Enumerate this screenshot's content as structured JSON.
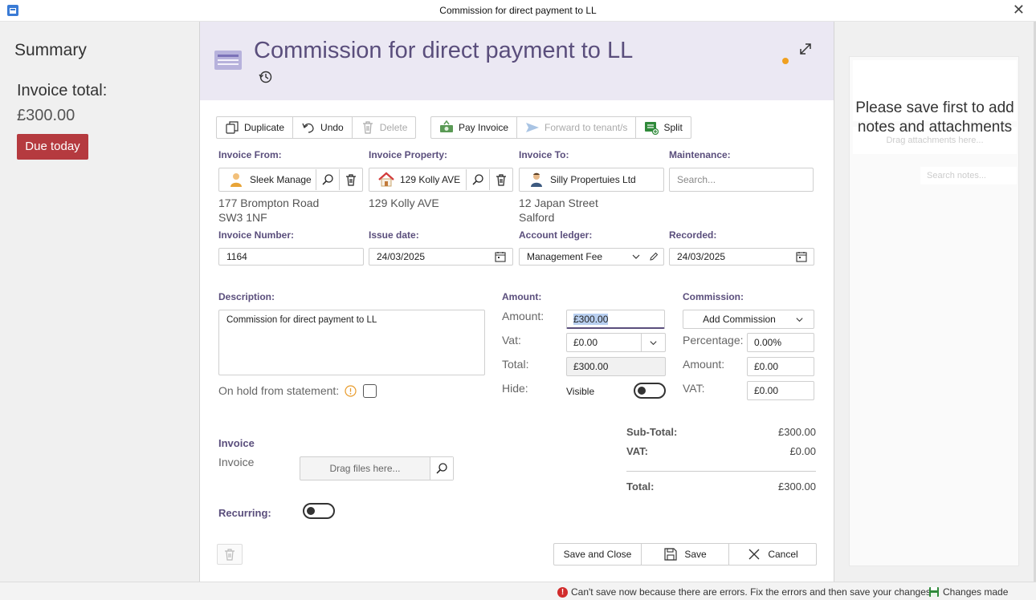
{
  "window": {
    "title": "Commission for direct payment to LL"
  },
  "summary": {
    "heading": "Summary",
    "invoice_total_label": "Invoice total:",
    "invoice_total_value": "£300.00",
    "due_badge": "Due today"
  },
  "header": {
    "title": "Commission for direct payment to LL"
  },
  "toolbar": {
    "duplicate": "Duplicate",
    "undo": "Undo",
    "delete": "Delete",
    "pay_invoice": "Pay Invoice",
    "forward": "Forward to tenant/s",
    "split": "Split"
  },
  "form": {
    "invoice_from": {
      "label": "Invoice From:",
      "value": "Sleek Manage",
      "address_line1": "177 Brompton Road",
      "address_line2": "SW3 1NF"
    },
    "invoice_property": {
      "label": "Invoice Property:",
      "value": "129 Kolly AVE",
      "address_line1": "129 Kolly AVE"
    },
    "invoice_to": {
      "label": "Invoice To:",
      "value": "Silly Propertuies Ltd",
      "address_line1": "12 Japan Street",
      "address_line2": "Salford"
    },
    "maintenance": {
      "label": "Maintenance:",
      "placeholder": "Search..."
    },
    "invoice_number": {
      "label": "Invoice Number:",
      "value": "1164"
    },
    "issue_date": {
      "label": "Issue date:",
      "value": "24/03/2025"
    },
    "account_ledger": {
      "label": "Account ledger:",
      "value": "Management Fee"
    },
    "recorded": {
      "label": "Recorded:",
      "value": "24/03/2025"
    },
    "description": {
      "label": "Description:",
      "value": "Commission for direct payment to LL"
    },
    "on_hold": {
      "label": "On hold from statement:"
    },
    "amount_section": {
      "heading": "Amount:",
      "amount_label": "Amount:",
      "amount_value": "£300.00",
      "vat_label": "Vat:",
      "vat_value": "£0.00",
      "total_label": "Total:",
      "total_value": "£300.00",
      "hide_label": "Hide:",
      "hide_value": "Visible"
    },
    "commission_section": {
      "heading": "Commission:",
      "add_commission": "Add Commission",
      "percentage_label": "Percentage:",
      "percentage_value": "0.00%",
      "amount_label": "Amount:",
      "amount_value": "£0.00",
      "vat_label": "VAT:",
      "vat_value": "£0.00"
    },
    "invoice_attach": {
      "heading": "Invoice",
      "label": "Invoice",
      "placeholder": "Drag files here..."
    },
    "recurring": {
      "label": "Recurring:"
    }
  },
  "totals": {
    "subtotal_label": "Sub-Total:",
    "subtotal_value": "£300.00",
    "vat_label": "VAT:",
    "vat_value": "£0.00",
    "total_label": "Total:",
    "total_value": "£300.00"
  },
  "footer": {
    "save_close": "Save and Close",
    "save": "Save",
    "cancel": "Cancel"
  },
  "notes": {
    "message": "Please save first to add notes and attachments",
    "drag_placeholder": "Drag attachments here...",
    "search_placeholder": "Search notes..."
  },
  "status": {
    "error": "Can't save now because there are errors. Fix the errors and then save your changes",
    "changes": "Changes made"
  },
  "colors": {
    "accent": "#5a4e7c",
    "due_badge": "#b53a3f",
    "header_band": "#ebe8f3"
  }
}
